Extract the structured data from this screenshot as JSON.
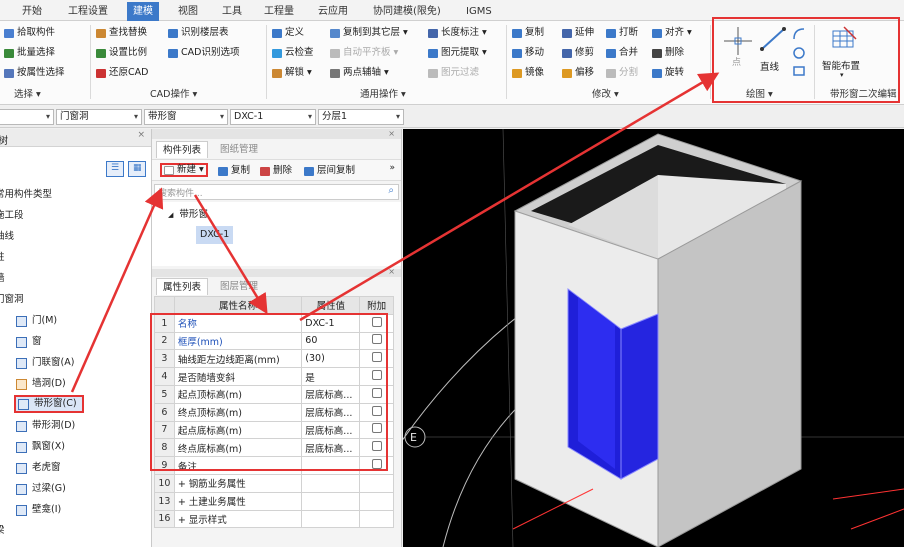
{
  "tabs": [
    "开始",
    "工程设置",
    "建模",
    "视图",
    "工具",
    "工程量",
    "云应用",
    "协同建模(限免)",
    "IGMS"
  ],
  "ribbon": {
    "select": {
      "items": [
        "拾取构件",
        "批量选择",
        "按属性选择"
      ],
      "label": "选择 ▾"
    },
    "cad": {
      "items": [
        "查找替换",
        "识别楼层表",
        "设置比例",
        "CAD识别选项",
        "还原CAD"
      ],
      "label": "CAD操作 ▾"
    },
    "general": {
      "items": [
        "定义",
        "复制到其它层 ▾",
        "长度标注 ▾",
        "云检查",
        "自动平齐板 ▾",
        "图元提取 ▾",
        "解锁 ▾",
        "两点辅轴 ▾",
        "图元过滤"
      ],
      "label": "通用操作 ▾"
    },
    "modify": {
      "items": [
        "复制",
        "延伸",
        "打断",
        "对齐 ▾",
        "移动",
        "修剪",
        "合并",
        "删除",
        "镜像",
        "偏移",
        "分割",
        "旋转"
      ],
      "label": "修改 ▾"
    },
    "draw": {
      "items": [
        "点",
        "直线"
      ],
      "label": "绘图 ▾"
    },
    "smart": {
      "items": [
        "智能布置"
      ],
      "label": "带形窗二次编辑"
    }
  },
  "toolbar2": {
    "combo1": "",
    "combo2": "门窗洞",
    "combo3": "带形窗",
    "combo4": "DXC-1",
    "combo5": "分层1"
  },
  "lefttree": {
    "header": "树",
    "items": [
      "常用构件类型",
      "施工段",
      "轴线",
      "柱",
      "墙",
      "门窗洞",
      "门(M)",
      "窗",
      "门联窗(A)",
      "墙洞(D)",
      "带形窗(C)",
      "带形洞(D)",
      "飘窗(X)",
      "老虎窗",
      "过梁(G)",
      "壁龛(I)",
      "梁"
    ]
  },
  "componentlist": {
    "tabs": [
      "构件列表",
      "图纸管理"
    ],
    "toolbar": [
      "新建 ▾",
      "复制",
      "删除",
      "层间复制"
    ],
    "search_placeholder": "搜索构件...",
    "tree_parent": "带形窗",
    "tree_child": "DXC-1"
  },
  "proplist": {
    "tabs": [
      "属性列表",
      "图层管理"
    ],
    "headers": [
      "属性名称",
      "属性值",
      "附加"
    ],
    "rows": [
      {
        "num": "1",
        "name": "名称",
        "value": "DXC-1",
        "blue": true
      },
      {
        "num": "2",
        "name": "框厚(mm)",
        "value": "60",
        "blue": true
      },
      {
        "num": "3",
        "name": "轴线距左边线距离(mm)",
        "value": "(30)",
        "blue": false
      },
      {
        "num": "4",
        "name": "是否随墙变斜",
        "value": "是",
        "blue": false
      },
      {
        "num": "5",
        "name": "起点顶标高(m)",
        "value": "层底标高...",
        "blue": false
      },
      {
        "num": "6",
        "name": "终点顶标高(m)",
        "value": "层底标高...",
        "blue": false
      },
      {
        "num": "7",
        "name": "起点底标高(m)",
        "value": "层底标高...",
        "blue": false
      },
      {
        "num": "8",
        "name": "终点底标高(m)",
        "value": "层底标高...",
        "blue": false
      },
      {
        "num": "9",
        "name": "备注",
        "value": "",
        "blue": false
      },
      {
        "num": "10",
        "name": "+ 钢筋业务属性",
        "value": "",
        "blue": false
      },
      {
        "num": "13",
        "name": "+ 土建业务属性",
        "value": "",
        "blue": false
      },
      {
        "num": "16",
        "name": "+ 显示样式",
        "value": "",
        "blue": false
      }
    ]
  },
  "viewport": {
    "axis_label": "E"
  },
  "colors": {
    "accent": "#3c79c9",
    "highlight": "#e53333",
    "window_blue": "#1f1fd9"
  }
}
